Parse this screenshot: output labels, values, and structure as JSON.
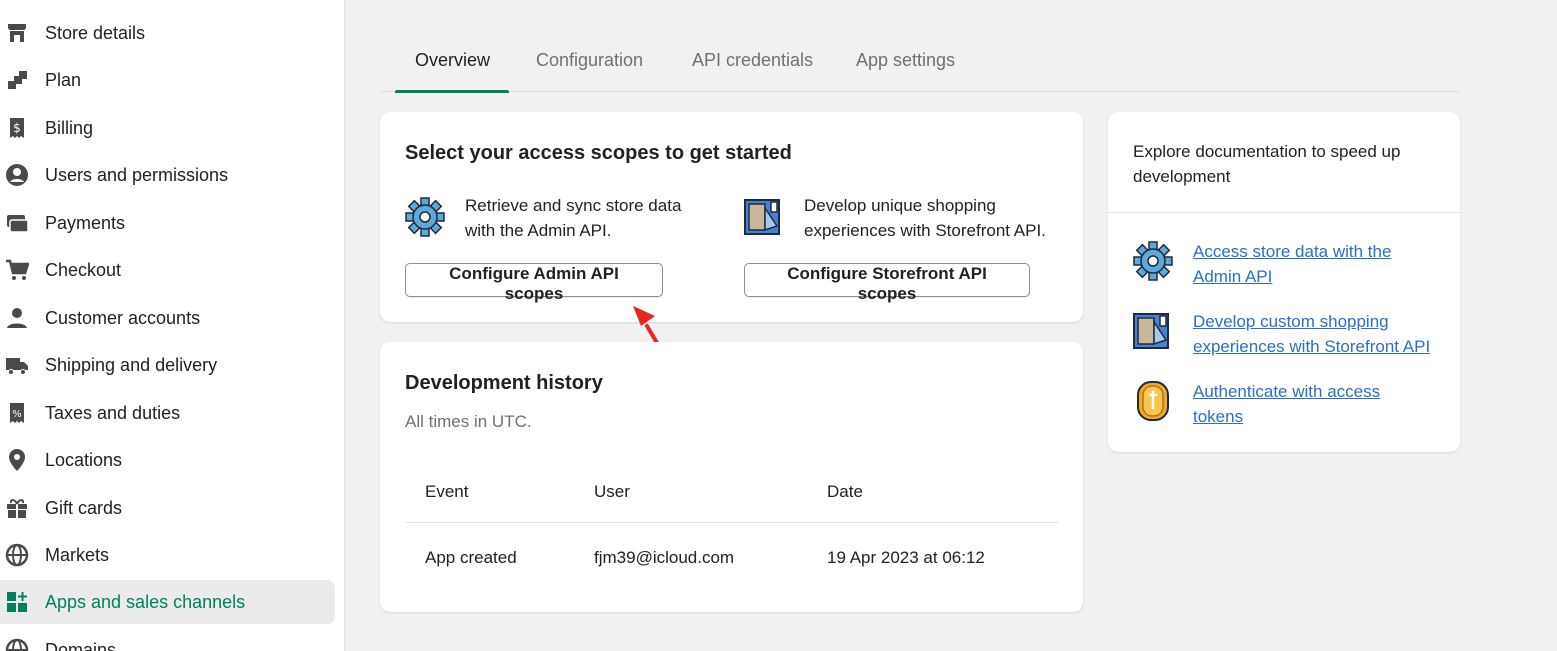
{
  "sidebar": {
    "items": [
      {
        "label": "Store details",
        "icon": "store-icon"
      },
      {
        "label": "Plan",
        "icon": "plan-icon"
      },
      {
        "label": "Billing",
        "icon": "billing-icon"
      },
      {
        "label": "Users and permissions",
        "icon": "user-circle-icon"
      },
      {
        "label": "Payments",
        "icon": "payments-icon"
      },
      {
        "label": "Checkout",
        "icon": "cart-icon"
      },
      {
        "label": "Customer accounts",
        "icon": "person-icon"
      },
      {
        "label": "Shipping and delivery",
        "icon": "truck-icon"
      },
      {
        "label": "Taxes and duties",
        "icon": "tax-receipt-icon"
      },
      {
        "label": "Locations",
        "icon": "location-pin-icon"
      },
      {
        "label": "Gift cards",
        "icon": "gift-icon"
      },
      {
        "label": "Markets",
        "icon": "globe-icon"
      },
      {
        "label": "Apps and sales channels",
        "icon": "apps-icon",
        "active": true
      },
      {
        "label": "Domains",
        "icon": "domains-globe-icon"
      }
    ]
  },
  "tabs": [
    {
      "label": "Overview",
      "active": true
    },
    {
      "label": "Configuration"
    },
    {
      "label": "API credentials"
    },
    {
      "label": "App settings"
    }
  ],
  "scopes_card": {
    "title": "Select your access scopes to get started",
    "admin": {
      "line1": "Retrieve and sync store data",
      "line2": "with the Admin API.",
      "button": "Configure Admin API scopes",
      "icon": "gear-icon"
    },
    "storefront": {
      "line1": "Develop unique shopping",
      "line2": "experiences with Storefront API.",
      "button": "Configure Storefront API scopes",
      "icon": "storefront-blueprint-icon"
    }
  },
  "history_card": {
    "title": "Development history",
    "subtitle": "All times in UTC.",
    "columns": [
      "Event",
      "User",
      "Date"
    ],
    "rows": [
      {
        "event": "App created",
        "user": "fjm39@icloud.com",
        "date": "19 Apr 2023 at 06:12"
      }
    ]
  },
  "docs_card": {
    "intro_line1": "Explore documentation to speed up",
    "intro_line2": "development",
    "links": [
      {
        "line1": "Access store data with the",
        "line2": "Admin API",
        "icon": "gear-icon"
      },
      {
        "line1": "Develop custom shopping",
        "line2": "experiences with Storefront API",
        "icon": "storefront-blueprint-icon"
      },
      {
        "line1": "Authenticate with access",
        "line2": "tokens",
        "icon": "token-coin-icon"
      }
    ]
  },
  "colors": {
    "accent": "#008060",
    "link": "#2c6ecb",
    "annotation_arrow": "#e8271c"
  }
}
